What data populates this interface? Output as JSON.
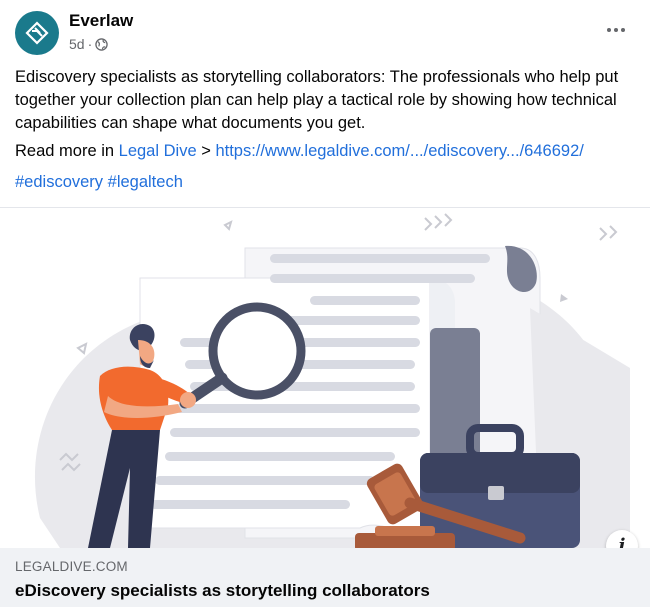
{
  "post": {
    "page_name": "Everlaw",
    "time": "5d",
    "audience_icon": "globe-icon",
    "more_icon": "more-horizontal-icon",
    "body": "Ediscovery specialists as storytelling collaborators: The professionals who help put together your collection plan can help play a tactical role by showing how technical capabilities can shape what documents you get.",
    "read_more_prefix": "Read more in",
    "read_more_source": "Legal Dive",
    "read_more_arrow": ">",
    "read_more_url": "https://www.legaldive.com/.../ediscovery.../646692/",
    "hashtags": [
      "#ediscovery",
      "#legaltech"
    ]
  },
  "link_preview": {
    "domain": "LEGALDIVE.COM",
    "title": "eDiscovery specialists as storytelling collaborators",
    "info_label": "i",
    "info_icon": "info-icon"
  },
  "colors": {
    "link": "#216fdb",
    "avatar": "#1a7a8c",
    "preview_bg": "#f0f2f5"
  }
}
